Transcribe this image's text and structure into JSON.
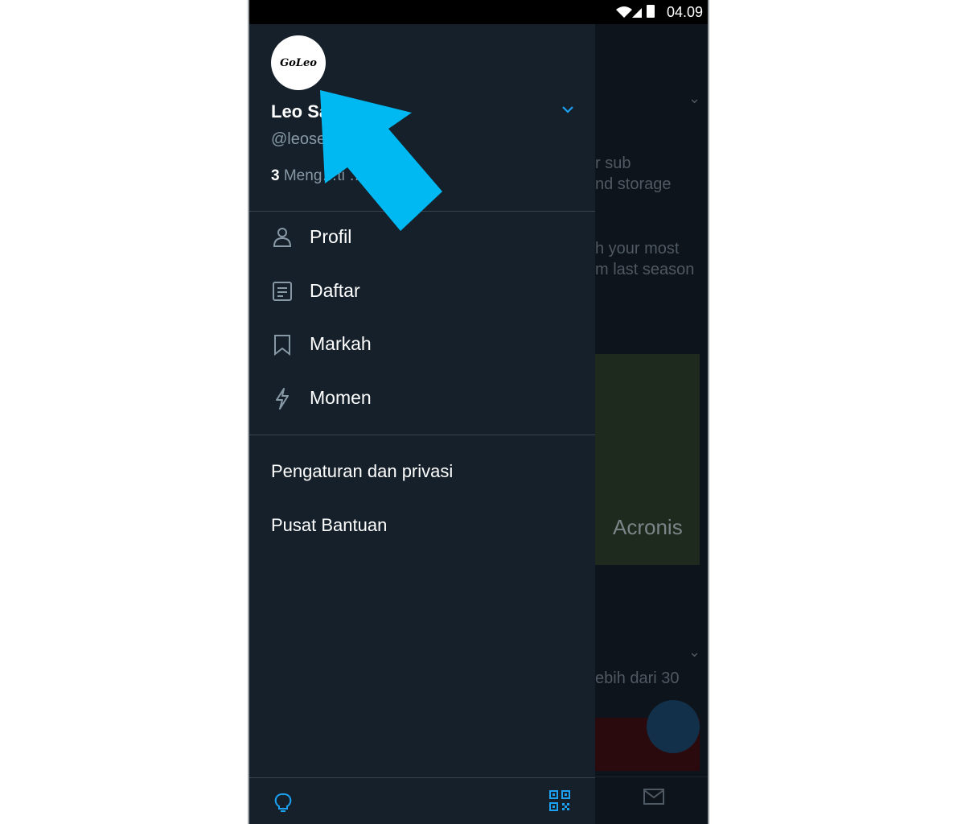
{
  "status_bar": {
    "time": "04.09"
  },
  "drawer": {
    "avatar_text": "GoLeo",
    "name": "Leo Sa",
    "handle": "@leose",
    "follow": {
      "count": "3",
      "text": " Meng…ti …ikut"
    },
    "menu": [
      {
        "label": "Profil",
        "icon": "person-icon"
      },
      {
        "label": "Daftar",
        "icon": "list-icon"
      },
      {
        "label": "Markah",
        "icon": "bookmark-icon"
      },
      {
        "label": "Momen",
        "icon": "lightning-icon"
      }
    ],
    "settings": "Pengaturan dan privasi",
    "help": "Pusat Bantuan"
  },
  "background_feed": {
    "line1": "r sub",
    "line2": "nd storage",
    "line3": "h your most",
    "line4": "m last season",
    "brand": "Acronis",
    "line5": "ebih dari 30"
  },
  "colors": {
    "accent": "#1da1f2",
    "drawer_bg": "#15202b",
    "arrow": "#00b9f2"
  }
}
